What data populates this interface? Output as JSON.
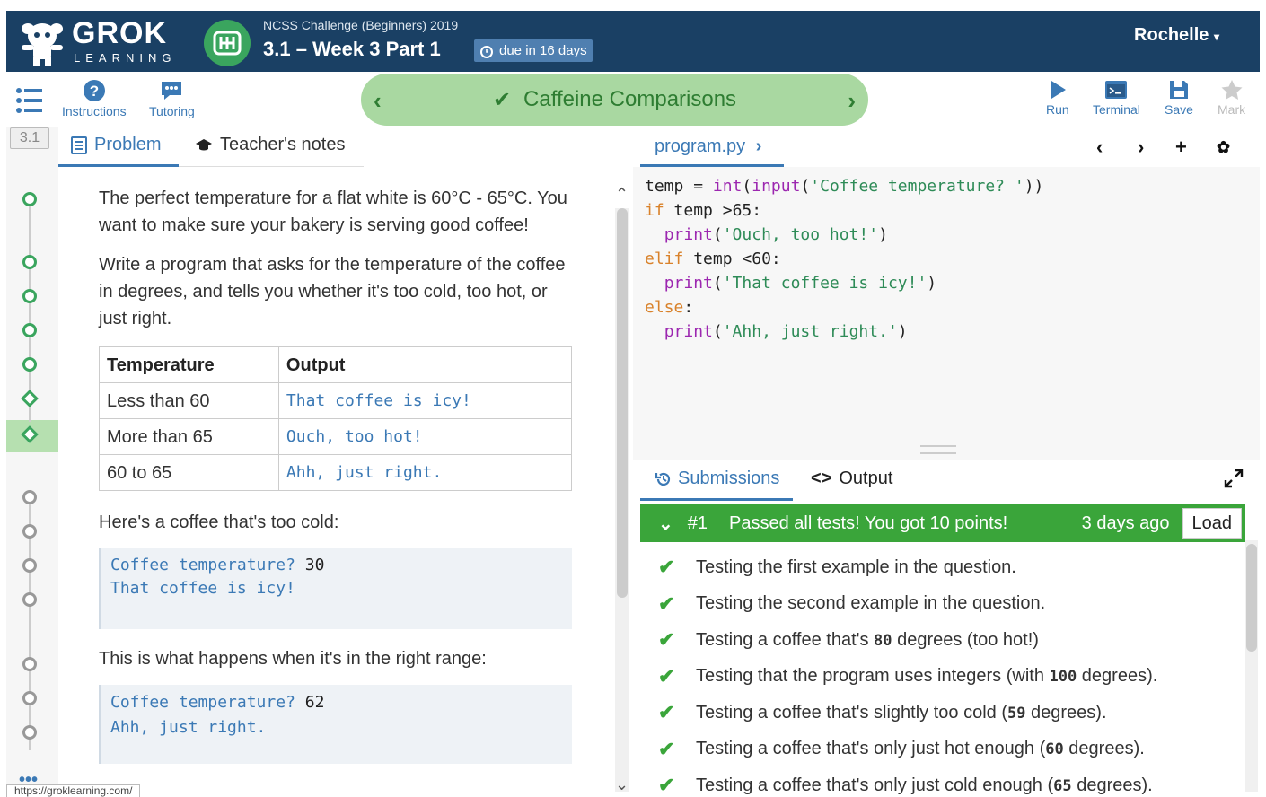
{
  "header": {
    "logo_text": "GROK",
    "logo_sub": "LEARNING",
    "course_name": "NCSS Challenge (Beginners) 2019",
    "module_title": "3.1 – Week 3 Part 1",
    "due_badge": "due in 16 days",
    "user_name": "Rochelle"
  },
  "toolbar": {
    "instructions_label": "Instructions",
    "tutoring_label": "Tutoring",
    "nav_title": "Caffeine Comparisons",
    "run_label": "Run",
    "terminal_label": "Terminal",
    "save_label": "Save",
    "mark_label": "Mark"
  },
  "rail": {
    "section_label": "3.1"
  },
  "problem_tabs": {
    "problem": "Problem",
    "teacher_notes": "Teacher's notes"
  },
  "problem": {
    "para1": "The perfect temperature for a flat white is 60°C - 65°C. You want to make sure your bakery is serving good coffee!",
    "para2": "Write a program that asks for the temperature of the coffee in degrees, and tells you whether it's too cold, too hot, or just right.",
    "table_headers": [
      "Temperature",
      "Output"
    ],
    "table_rows": [
      [
        "Less than 60",
        "That coffee is icy!"
      ],
      [
        "More than 65",
        "Ouch, too hot!"
      ],
      [
        "60 to 65",
        "Ahh, just right."
      ]
    ],
    "example1_intro": "Here's a coffee that's too cold:",
    "example1_prompt": "Coffee temperature? ",
    "example1_input": "30",
    "example1_output": "That coffee is icy!",
    "example2_intro": "This is what happens when it's in the right range:",
    "example2_prompt": "Coffee temperature? ",
    "example2_input": "62",
    "example2_output": "Ahh, just right."
  },
  "status_url": "https://groklearning.com/",
  "editor": {
    "file_name": "program.py",
    "code_lines": [
      "temp = int(input('Coffee temperature? '))",
      "if temp >65:",
      "  print('Ouch, too hot!')",
      "elif temp <60:",
      "  print('That coffee is icy!')",
      "else:",
      "  print('Ahh, just right.')"
    ]
  },
  "submissions": {
    "tab_submissions": "Submissions",
    "tab_output": "Output",
    "result_number": "#1",
    "result_message": "Passed all tests! You got 10 points!",
    "result_time": "3 days ago",
    "load_label": "Load",
    "tests": [
      {
        "pre": "Testing the first example in the question.",
        "code": "",
        "post": ""
      },
      {
        "pre": "Testing the second example in the question.",
        "code": "",
        "post": ""
      },
      {
        "pre": "Testing a coffee that's ",
        "code": "80",
        "post": " degrees (too hot!)"
      },
      {
        "pre": "Testing that the program uses integers (with ",
        "code": "100",
        "post": " degrees)."
      },
      {
        "pre": "Testing a coffee that's slightly too cold (",
        "code": "59",
        "post": " degrees)."
      },
      {
        "pre": "Testing a coffee that's only just hot enough (",
        "code": "60",
        "post": " degrees)."
      },
      {
        "pre": "Testing a coffee that's only just cold enough (",
        "code": "65",
        "post": " degrees)."
      }
    ]
  },
  "colors": {
    "header_bg": "#1a4064",
    "accent_blue": "#3b79b5",
    "success_green": "#3aa53a",
    "nav_banner": "#a9d8a1"
  }
}
